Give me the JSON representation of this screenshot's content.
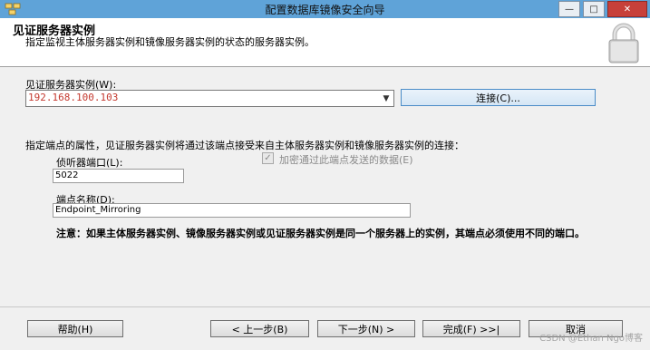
{
  "window": {
    "title": "配置数据库镜像安全向导",
    "minimize": "—",
    "maximize": "□",
    "close": "✕"
  },
  "header": {
    "title": "见证服务器实例",
    "description": "指定监视主体服务器实例和镜像服务器实例的状态的服务器实例。"
  },
  "witness": {
    "label": "见证服务器实例(W):",
    "value": "192.168.100.103",
    "connect_button": "连接(C)..."
  },
  "endpoint": {
    "intro": "指定端点的属性，见证服务器实例将通过该端点接受来自主体服务器实例和镜像服务器实例的连接：",
    "port_label": "侦听器端口(L):",
    "port_value": "5022",
    "encrypt_label": "加密通过此端点发送的数据(E)",
    "encrypt_checked": true,
    "name_label": "端点名称(D):",
    "name_value": "Endpoint_Mirroring"
  },
  "note": "注意：如果主体服务器实例、镜像服务器实例或见证服务器实例是同一个服务器上的实例，其端点必须使用不同的端口。",
  "footer": {
    "help": "帮助(H)",
    "back": "< 上一步(B)",
    "next": "下一步(N) >",
    "finish": "完成(F) >>|",
    "cancel": "取消"
  },
  "watermark": "CSDN @Ethan Ngo博客"
}
